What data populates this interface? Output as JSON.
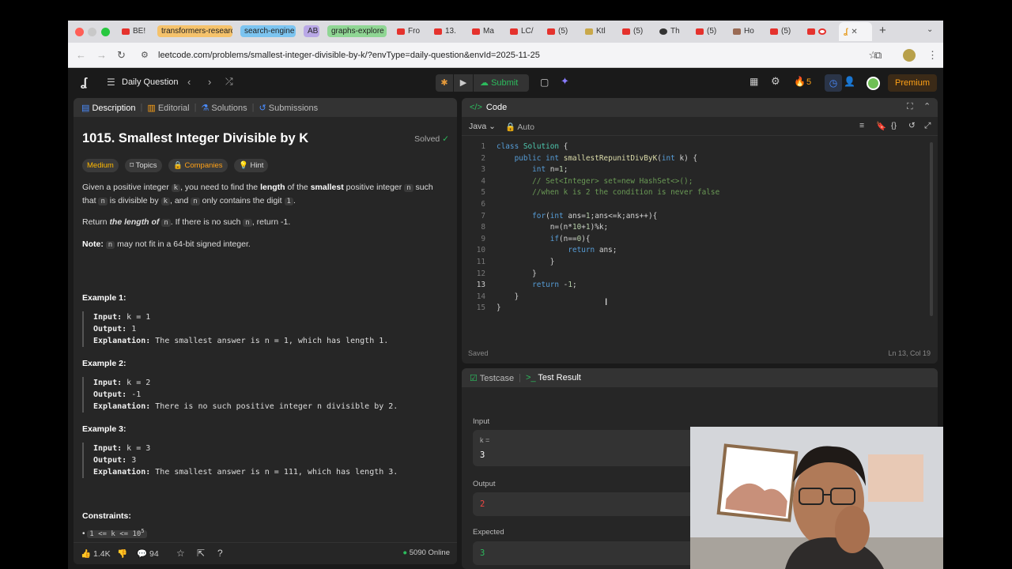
{
  "browser": {
    "tabs": [
      {
        "label": "BE!"
      },
      {
        "label": "transformers-researc",
        "pill": true,
        "color": "#f5c26b"
      },
      {
        "label": "search-engine",
        "pill": true,
        "color": "#7cc4f0"
      },
      {
        "label": "AB",
        "pill": true,
        "color": "#b9a8e6"
      },
      {
        "label": "graphs-explore",
        "pill": true,
        "color": "#8fd694"
      },
      {
        "label": "Fro"
      },
      {
        "label": "13."
      },
      {
        "label": "Ma"
      },
      {
        "label": "LC/"
      },
      {
        "label": "(5)"
      },
      {
        "label": "Ktl"
      },
      {
        "label": "(5)"
      },
      {
        "label": "Th"
      },
      {
        "label": "(5)"
      },
      {
        "label": "Ho"
      },
      {
        "label": "(5)"
      }
    ],
    "new_tab": "+",
    "url": "leetcode.com/problems/smallest-integer-divisible-by-k/?envType=daily-question&envId=2025-11-25"
  },
  "topbar": {
    "daily_label": "Daily Question",
    "submit_label": "Submit",
    "streak": "5",
    "premium_label": "Premium"
  },
  "left_tabs": {
    "description": "Description",
    "editorial": "Editorial",
    "solutions": "Solutions",
    "submissions": "Submissions"
  },
  "problem": {
    "title": "1015. Smallest Integer Divisible by K",
    "status": "Solved",
    "difficulty": "Medium",
    "topics": "Topics",
    "companies": "Companies",
    "hint": "Hint",
    "desc_p1_a": "Given a positive integer ",
    "desc_p1_k": "k",
    "desc_p1_b": ", you need to find the ",
    "desc_p1_length": "length",
    "desc_p1_c": " of the ",
    "desc_p1_smallest": "smallest",
    "desc_p1_d": " positive integer ",
    "desc_p1_n": "n",
    "desc_p1_e": " such",
    "desc_p1_f": "that ",
    "desc_p1_g": " is divisible by ",
    "desc_p1_h": ", and ",
    "desc_p1_i": " only contains the digit ",
    "desc_p1_one": "1",
    "desc_p1_j": ".",
    "desc_p2_a": "Return ",
    "desc_p2_em": "the length of ",
    "desc_p2_b": ". If there is no such ",
    "desc_p2_c": ", return -1.",
    "note_label": "Note:",
    "note_text": " may not fit in a 64-bit signed integer.",
    "examples": [
      {
        "title": "Example 1:",
        "input": "k = 1",
        "output": "1",
        "explanation": "The smallest answer is n = 1, which has length 1."
      },
      {
        "title": "Example 2:",
        "input": "k = 2",
        "output": "-1",
        "explanation": "There is no such positive integer n divisible by 2."
      },
      {
        "title": "Example 3:",
        "input": "k = 3",
        "output": "3",
        "explanation": "The smallest answer is n = 111, which has length 3."
      }
    ],
    "input_label": "Input:",
    "output_label": "Output:",
    "explanation_label": "Explanation:",
    "constraints_title": "Constraints:",
    "constraint_1": "1 <= k <= 10",
    "constraint_1_sup": "5"
  },
  "footer": {
    "likes": "1.4K",
    "comments": "94",
    "online": "5090 Online"
  },
  "code_panel": {
    "title": "Code",
    "language": "Java",
    "auto_label": "Auto",
    "saved": "Saved",
    "cursor_pos": "Ln 13, Col 19",
    "lines": [
      "1",
      "2",
      "3",
      "4",
      "5",
      "6",
      "7",
      "8",
      "9",
      "10",
      "11",
      "12",
      "13",
      "14",
      "15"
    ]
  },
  "test_panel": {
    "testcase_tab": "Testcase",
    "result_tab": "Test Result",
    "input_label": "Input",
    "k_label": "k =",
    "k_value": "3",
    "output_label": "Output",
    "output_value": "2",
    "expected_label": "Expected",
    "expected_value": "3"
  }
}
